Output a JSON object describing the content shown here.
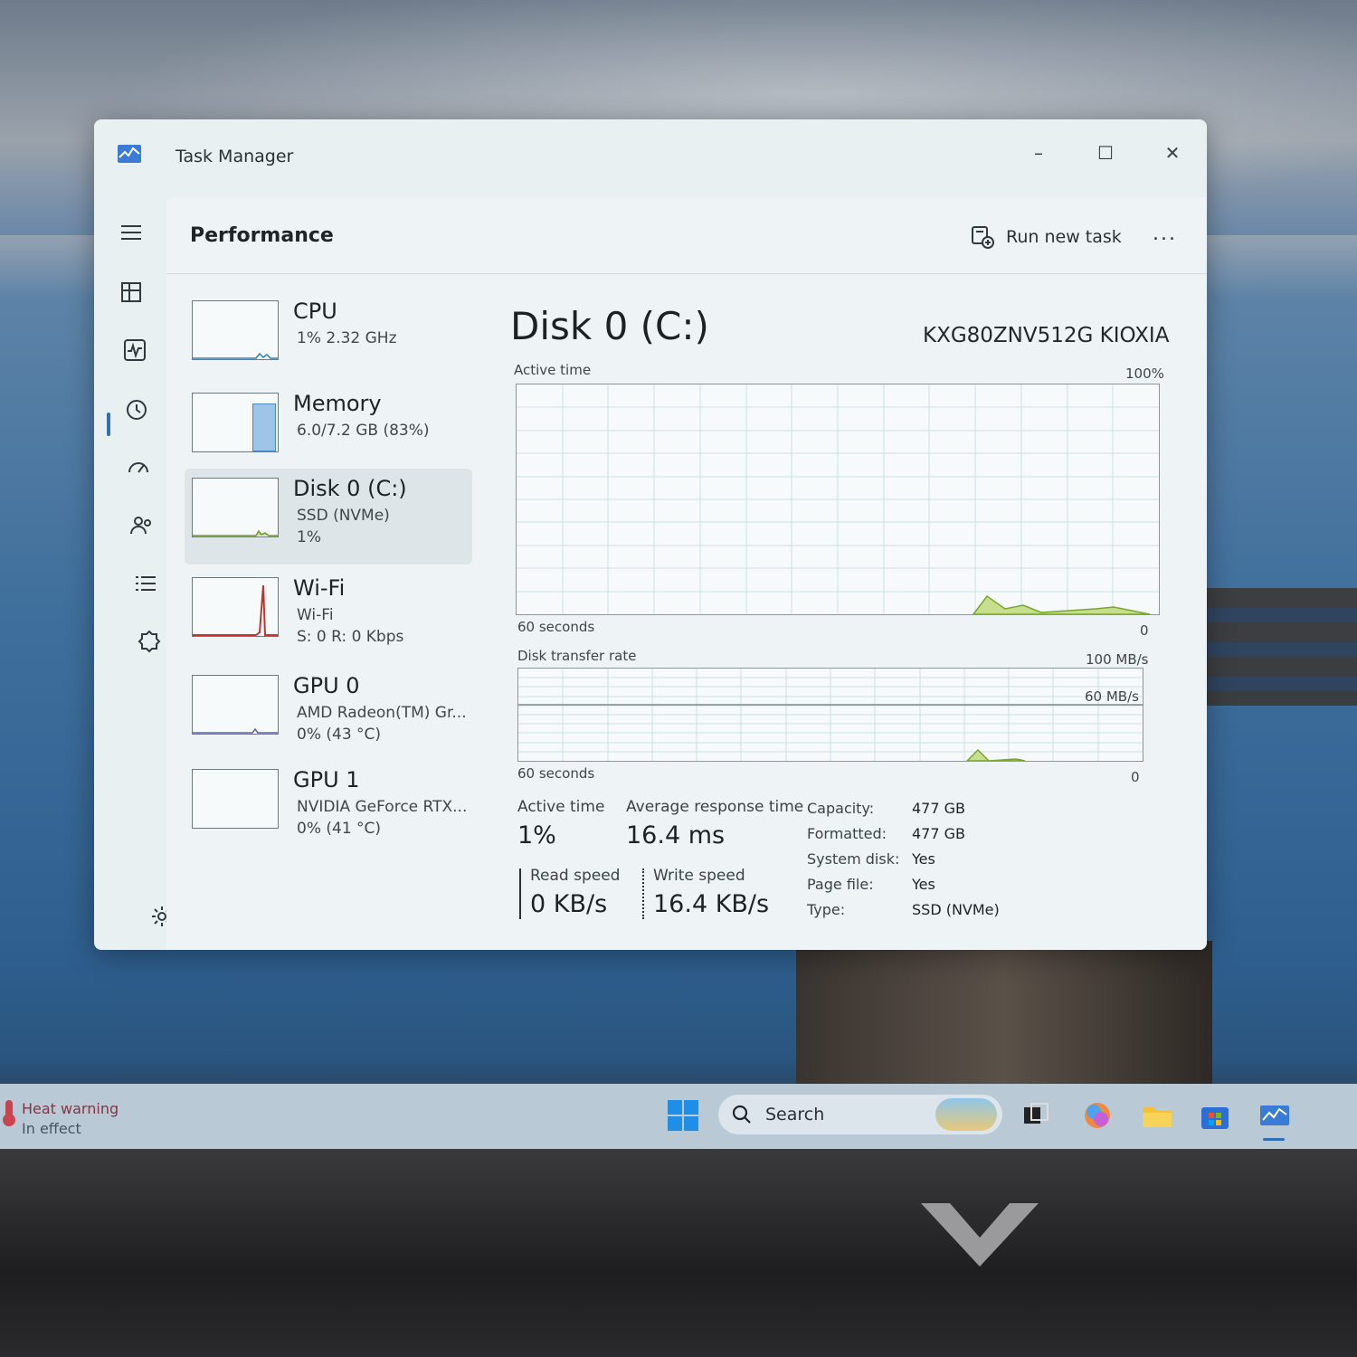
{
  "window": {
    "title": "Task Manager"
  },
  "header": {
    "section": "Performance",
    "run_new_task": "Run new task",
    "more": "..."
  },
  "devices": [
    {
      "name": "CPU",
      "line1": "1%  2.32 GHz",
      "line2": ""
    },
    {
      "name": "Memory",
      "line1": "6.0/7.2 GB (83%)",
      "line2": ""
    },
    {
      "name": "Disk 0 (C:)",
      "line1": "SSD (NVMe)",
      "line2": "1%"
    },
    {
      "name": "Wi-Fi",
      "line1": "Wi-Fi",
      "line2": "S: 0 R: 0 Kbps"
    },
    {
      "name": "GPU 0",
      "line1": "AMD Radeon(TM) Gr...",
      "line2": "0%  (43 °C)"
    },
    {
      "name": "GPU 1",
      "line1": "NVIDIA GeForce RTX...",
      "line2": "0%  (41 °C)"
    }
  ],
  "memory_usage_fraction": 0.83,
  "disk": {
    "title": "Disk 0 (C:)",
    "model": "KXG80ZNV512G KIOXIA",
    "active_time_graph": {
      "label": "Active time",
      "max": "100%",
      "time": "60 seconds",
      "min": "0"
    },
    "transfer_graph": {
      "label": "Disk transfer rate",
      "max": "100 MB/s",
      "mid": "60 MB/s",
      "time": "60 seconds",
      "min": "0"
    },
    "stats": {
      "active_time_label": "Active time",
      "active_time": "1%",
      "avg_response_label": "Average response time",
      "avg_response": "16.4 ms",
      "read_label": "Read speed",
      "read": "0 KB/s",
      "write_label": "Write speed",
      "write": "16.4 KB/s"
    },
    "info": [
      {
        "k": "Capacity:",
        "v": "477 GB"
      },
      {
        "k": "Formatted:",
        "v": "477 GB"
      },
      {
        "k": "System disk:",
        "v": "Yes"
      },
      {
        "k": "Page file:",
        "v": "Yes"
      },
      {
        "k": "Type:",
        "v": "SSD (NVMe)"
      }
    ]
  },
  "taskbar": {
    "heat_title": "Heat warning",
    "heat_sub": "In effect",
    "search": "Search"
  },
  "colors": {
    "accent": "#2f6fb2",
    "memory_fill": "#9ec4e8",
    "disk_graph": "#9cc24a",
    "wifi_spike": "#c2342e"
  }
}
